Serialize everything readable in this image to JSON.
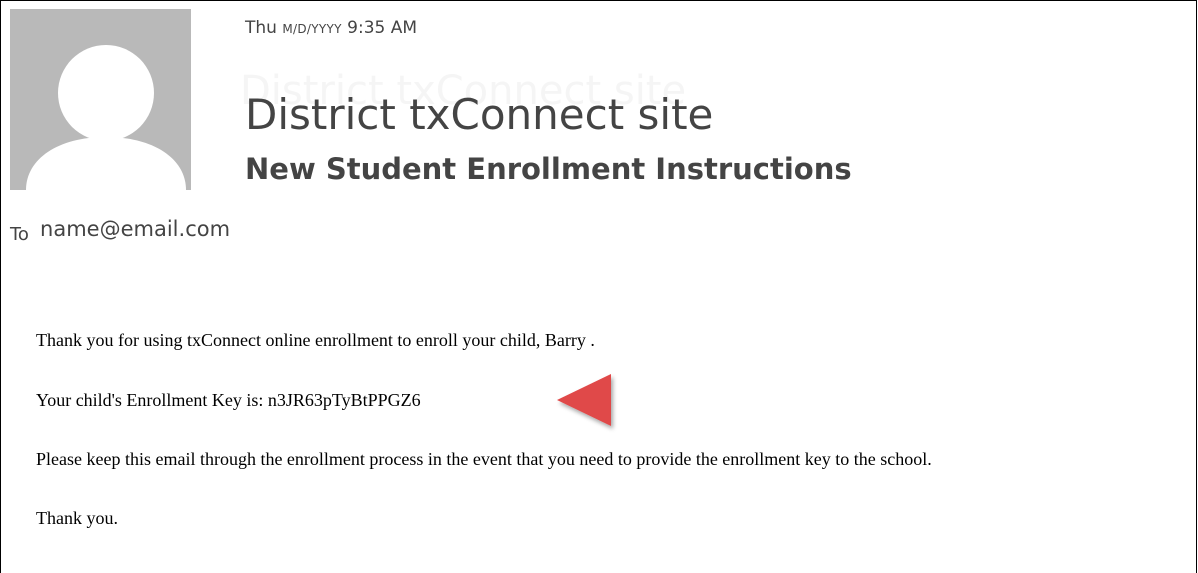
{
  "email": {
    "date_prefix": "Thu",
    "date_format": "M/D/YYYY",
    "time": "9:35 AM",
    "from_blurred": "District txConnect site",
    "sender": "District txConnect site",
    "subject": "New Student Enrollment Instructions",
    "to_label": "To",
    "to_address": "name@email.com"
  },
  "body": {
    "line1": "Thank you for using txConnect online enrollment to enroll your child, Barry .",
    "line2": "Your child's Enrollment Key is: n3JR63pTyBtPPGZ6",
    "line3": "Please keep this email through the enrollment process in the event that you need to provide the enrollment key to the school.",
    "line4": "Thank you."
  },
  "colors": {
    "avatar_bg": "#b9b9b9",
    "avatar_fg": "#ffffff",
    "header_text": "#444444",
    "arrow": "#e04848"
  },
  "icons": {
    "avatar": "person-silhouette-icon",
    "pointer": "red-triangle-arrow-icon"
  }
}
